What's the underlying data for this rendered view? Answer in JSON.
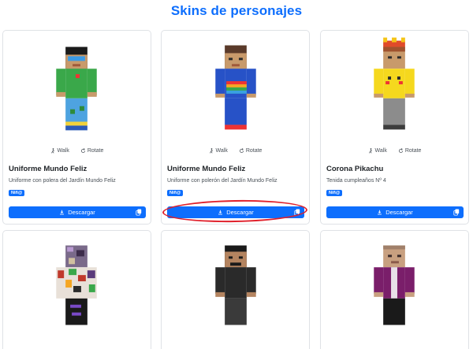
{
  "page": {
    "title": "Skins de personajes"
  },
  "colors": {
    "accent": "#0d6efd",
    "annotation": "#e0202b"
  },
  "controls": {
    "walk_label": "Walk",
    "rotate_label": "Rotate",
    "walk_icon": "walk-icon",
    "rotate_icon": "rotate-icon"
  },
  "cards": [
    {
      "name": "Uniforme Mundo Feliz",
      "description": "Uniforme con polera del Jardín Mundo Feliz",
      "badge": "Niñ@",
      "download_label": "Descargar"
    },
    {
      "name": "Uniforme Mundo Feliz",
      "description": "Uniforme con polerón del Jardín Mundo Feliz",
      "badge": "Niñ@",
      "download_label": "Descargar"
    },
    {
      "name": "Corona Pikachu",
      "description": "Tenida cumpleaños Nº 4",
      "badge": "Niñ@",
      "download_label": "Descargar"
    }
  ]
}
